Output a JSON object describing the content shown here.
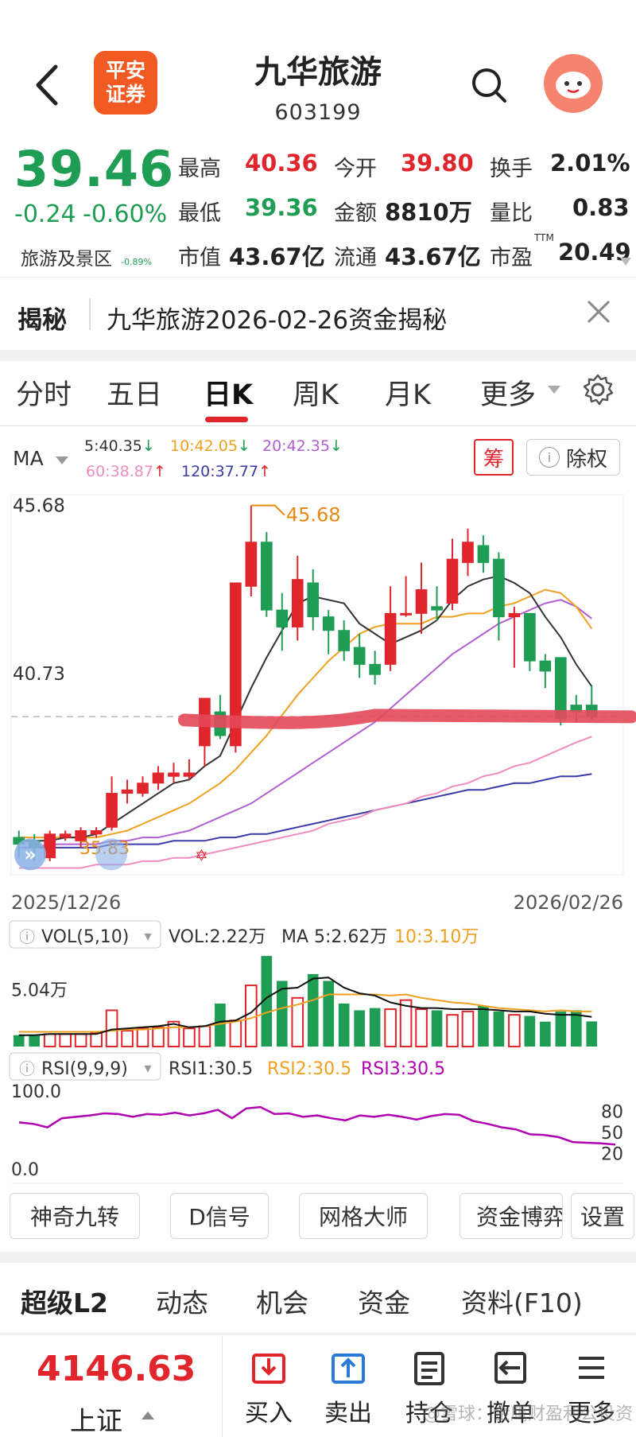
{
  "header": {
    "back_icon": "back-arrow-icon",
    "brand_logo": "平安证券",
    "stock_name": "九华旅游",
    "stock_code": "603199",
    "search_icon": "search-icon",
    "avatar_icon": "mascot-avatar-icon"
  },
  "quote": {
    "price": "39.46",
    "change": "-0.24",
    "change_pct": "-0.60%",
    "sector": "旅游及景区",
    "sector_pct": "-0.89%",
    "high_label": "最高",
    "high": "40.36",
    "low_label": "最低",
    "low": "39.36",
    "open_label": "今开",
    "open": "39.80",
    "amount_label": "金额",
    "amount": "8810万",
    "turnover_label": "换手",
    "turnover": "2.01%",
    "vol_ratio_label": "量比",
    "vol_ratio": "0.83",
    "mktcap_label": "市值",
    "mktcap": "43.67亿",
    "float_label": "流通",
    "float": "43.67亿",
    "pe_label": "市盈",
    "pe_sup": "TTM",
    "pe": "20.49"
  },
  "news": {
    "tag": "揭秘",
    "text": "九华旅游2026-02-26资金揭秘",
    "close_icon": "close-icon"
  },
  "tabs": {
    "items": [
      "分时",
      "五日",
      "日K",
      "周K",
      "月K",
      "更多"
    ],
    "active": "日K",
    "settings_icon": "gear-icon"
  },
  "chart_legend": {
    "ma_label": "MA",
    "ma5": "5:40.35",
    "ma10": "10:42.05",
    "ma20": "20:42.35",
    "ma60": "60:38.87",
    "ma120": "120:37.77",
    "chip_btn": "筹",
    "exright_btn": "除权"
  },
  "colors": {
    "up": "#e0252c",
    "down": "#1f9d55",
    "ma5": "#333333",
    "ma10": "#f0a020",
    "ma20": "#b05fd0",
    "ma60": "#f08cc0",
    "ma120": "#3a3aa8",
    "rsi": "#b000b0"
  },
  "chart_data": [
    {
      "type": "candlestick",
      "y_tick_labels": [
        "45.68",
        "40.73"
      ],
      "annotations": [
        "45.68",
        "35.83"
      ],
      "x_labels": [
        "2025/12/26",
        "2026/02/26"
      ],
      "ylim": [
        34.8,
        46.0
      ],
      "candles": [
        {
          "o": 35.9,
          "c": 35.7,
          "h": 36.1,
          "l": 35.3
        },
        {
          "o": 35.8,
          "c": 35.6,
          "h": 36.0,
          "l": 35.2
        },
        {
          "o": 35.3,
          "c": 36.0,
          "h": 36.1,
          "l": 35.2
        },
        {
          "o": 35.9,
          "c": 36.0,
          "h": 36.1,
          "l": 35.8
        },
        {
          "o": 35.8,
          "c": 36.1,
          "h": 36.2,
          "l": 35.6
        },
        {
          "o": 36.0,
          "c": 36.1,
          "h": 36.2,
          "l": 35.9
        },
        {
          "o": 36.2,
          "c": 37.2,
          "h": 37.7,
          "l": 36.1
        },
        {
          "o": 37.2,
          "c": 37.3,
          "h": 37.6,
          "l": 36.9
        },
        {
          "o": 37.2,
          "c": 37.5,
          "h": 37.7,
          "l": 37.1
        },
        {
          "o": 37.5,
          "c": 37.8,
          "h": 38.0,
          "l": 37.3
        },
        {
          "o": 37.7,
          "c": 37.8,
          "h": 38.1,
          "l": 37.5
        },
        {
          "o": 37.7,
          "c": 37.8,
          "h": 38.2,
          "l": 37.6
        },
        {
          "o": 38.6,
          "c": 40.0,
          "h": 40.0,
          "l": 38.0
        },
        {
          "o": 39.6,
          "c": 38.9,
          "h": 40.1,
          "l": 38.8
        },
        {
          "o": 38.6,
          "c": 43.4,
          "h": 43.4,
          "l": 38.4
        },
        {
          "o": 43.3,
          "c": 44.6,
          "h": 45.68,
          "l": 43.0
        },
        {
          "o": 44.6,
          "c": 42.6,
          "h": 44.9,
          "l": 42.4
        },
        {
          "o": 42.6,
          "c": 42.1,
          "h": 43.1,
          "l": 41.4
        },
        {
          "o": 42.1,
          "c": 43.5,
          "h": 44.2,
          "l": 41.7
        },
        {
          "o": 43.4,
          "c": 42.4,
          "h": 43.8,
          "l": 42.0
        },
        {
          "o": 42.4,
          "c": 42.0,
          "h": 42.6,
          "l": 41.3
        },
        {
          "o": 42.0,
          "c": 41.4,
          "h": 42.3,
          "l": 41.1
        },
        {
          "o": 41.5,
          "c": 41.0,
          "h": 41.9,
          "l": 40.6
        },
        {
          "o": 41.0,
          "c": 40.7,
          "h": 41.4,
          "l": 40.4
        },
        {
          "o": 41.0,
          "c": 42.5,
          "h": 43.3,
          "l": 40.8
        },
        {
          "o": 42.5,
          "c": 42.5,
          "h": 43.6,
          "l": 42.4
        },
        {
          "o": 42.5,
          "c": 43.2,
          "h": 44.0,
          "l": 41.9
        },
        {
          "o": 42.7,
          "c": 42.6,
          "h": 43.3,
          "l": 42.3
        },
        {
          "o": 42.8,
          "c": 44.1,
          "h": 44.7,
          "l": 42.6
        },
        {
          "o": 44.0,
          "c": 44.6,
          "h": 45.0,
          "l": 43.6
        },
        {
          "o": 44.5,
          "c": 44.0,
          "h": 44.8,
          "l": 43.7
        },
        {
          "o": 44.1,
          "c": 42.4,
          "h": 44.3,
          "l": 41.7
        },
        {
          "o": 42.4,
          "c": 42.5,
          "h": 42.7,
          "l": 40.9
        },
        {
          "o": 42.5,
          "c": 41.1,
          "h": 42.5,
          "l": 40.8
        },
        {
          "o": 41.1,
          "c": 40.8,
          "h": 41.3,
          "l": 40.3
        },
        {
          "o": 41.2,
          "c": 39.4,
          "h": 41.2,
          "l": 39.2
        },
        {
          "o": 39.8,
          "c": 39.6,
          "h": 40.1,
          "l": 39.3
        },
        {
          "o": 39.8,
          "c": 39.46,
          "h": 40.36,
          "l": 39.36
        }
      ],
      "ma5": [
        35.8,
        35.8,
        35.8,
        35.9,
        35.9,
        36.0,
        36.3,
        36.6,
        36.9,
        37.2,
        37.5,
        37.6,
        38.0,
        38.3,
        39.3,
        40.3,
        41.2,
        42.0,
        42.8,
        43.0,
        42.9,
        42.8,
        42.2,
        41.9,
        41.6,
        41.8,
        42.0,
        42.3,
        42.9,
        43.3,
        43.5,
        43.6,
        43.4,
        43.1,
        42.4,
        41.8,
        41.0,
        40.35
      ],
      "ma10": [
        35.9,
        35.9,
        35.9,
        35.9,
        35.9,
        35.9,
        36.0,
        36.1,
        36.3,
        36.5,
        36.7,
        36.9,
        37.2,
        37.5,
        37.9,
        38.4,
        38.9,
        39.5,
        40.1,
        40.6,
        41.1,
        41.5,
        41.9,
        42.1,
        42.2,
        42.2,
        42.2,
        42.4,
        42.4,
        42.5,
        42.5,
        42.7,
        42.8,
        43.0,
        43.2,
        43.1,
        42.7,
        42.05
      ],
      "ma20": [
        35.6,
        35.6,
        35.7,
        35.7,
        35.7,
        35.7,
        35.8,
        35.8,
        35.9,
        35.9,
        36.0,
        36.1,
        36.3,
        36.5,
        36.7,
        36.9,
        37.2,
        37.5,
        37.8,
        38.1,
        38.4,
        38.7,
        39.0,
        39.3,
        39.7,
        40.1,
        40.5,
        40.9,
        41.3,
        41.6,
        41.9,
        42.2,
        42.4,
        42.6,
        42.8,
        42.9,
        42.7,
        42.35
      ],
      "ma60": [
        35.0,
        35.0,
        35.0,
        35.0,
        35.0,
        35.1,
        35.1,
        35.1,
        35.2,
        35.2,
        35.3,
        35.3,
        35.4,
        35.5,
        35.6,
        35.7,
        35.8,
        35.9,
        36.0,
        36.1,
        36.3,
        36.4,
        36.5,
        36.7,
        36.8,
        36.9,
        37.1,
        37.2,
        37.4,
        37.5,
        37.7,
        37.8,
        38.0,
        38.1,
        38.3,
        38.5,
        38.7,
        38.87
      ],
      "ma120": [
        35.6,
        35.6,
        35.6,
        35.6,
        35.6,
        35.6,
        35.7,
        35.7,
        35.7,
        35.7,
        35.8,
        35.8,
        35.8,
        35.9,
        35.9,
        36.0,
        36.0,
        36.1,
        36.2,
        36.3,
        36.4,
        36.5,
        36.6,
        36.7,
        36.8,
        36.9,
        37.0,
        37.1,
        37.2,
        37.3,
        37.3,
        37.4,
        37.5,
        37.5,
        37.6,
        37.7,
        37.7,
        37.77
      ],
      "support_line": 39.5
    },
    {
      "type": "bar",
      "title": "VOL(5,10)",
      "readout": "VOL:2.22万",
      "ma5_readout": "MA 5:2.62万",
      "ma10_readout": "10:3.10万",
      "y_tick_label": "5.04万",
      "ylim": [
        0,
        8.5
      ],
      "values": [
        1.0,
        1.0,
        1.1,
        1.1,
        1.1,
        1.2,
        3.2,
        1.4,
        1.6,
        1.7,
        2.2,
        1.6,
        1.8,
        3.8,
        2.3,
        5.4,
        8.0,
        5.8,
        4.3,
        6.4,
        5.8,
        3.8,
        3.2,
        3.4,
        3.3,
        4.1,
        3.3,
        3.2,
        2.8,
        3.1,
        3.6,
        3.1,
        2.8,
        2.7,
        2.2,
        3.1,
        3.2,
        2.22
      ],
      "ma5_line": [
        1.0,
        1.0,
        1.1,
        1.1,
        1.1,
        1.1,
        1.5,
        1.6,
        1.7,
        1.8,
        2.0,
        1.7,
        1.8,
        2.2,
        2.3,
        3.0,
        4.3,
        5.1,
        5.2,
        6.0,
        6.1,
        5.2,
        4.7,
        4.5,
        3.9,
        3.6,
        3.4,
        3.4,
        3.3,
        3.3,
        3.3,
        3.2,
        3.1,
        3.1,
        2.9,
        2.8,
        2.8,
        2.62
      ],
      "ma10_line": [
        1.3,
        1.3,
        1.3,
        1.3,
        1.3,
        1.3,
        1.4,
        1.5,
        1.5,
        1.6,
        1.7,
        1.7,
        1.8,
        2.0,
        2.2,
        2.5,
        3.0,
        3.4,
        3.7,
        4.1,
        4.6,
        4.6,
        4.6,
        4.6,
        4.5,
        4.6,
        4.3,
        4.1,
        3.9,
        3.8,
        3.6,
        3.4,
        3.3,
        3.2,
        3.1,
        3.2,
        3.1,
        3.1
      ]
    },
    {
      "type": "line",
      "title": "RSI(9,9,9)",
      "rsi1_readout": "RSI1:30.5",
      "rsi2_readout": "RSI2:30.5",
      "rsi3_readout": "RSI3:30.5",
      "y_left_ticks": [
        "100.0",
        "0.0"
      ],
      "y_right_ticks": [
        "80",
        "50",
        "20"
      ],
      "ylim": [
        0,
        100
      ],
      "values": [
        62,
        60,
        55,
        68,
        70,
        72,
        75,
        74,
        70,
        74,
        73,
        76,
        72,
        75,
        80,
        68,
        82,
        84,
        74,
        75,
        70,
        72,
        68,
        65,
        72,
        70,
        73,
        70,
        66,
        71,
        74,
        73,
        64,
        60,
        55,
        52,
        45,
        44,
        41,
        34,
        33,
        32,
        30.5
      ]
    }
  ],
  "toolbar_buttons": [
    "神奇九转",
    "D信号",
    "网格大师",
    "资金博弈",
    "设置"
  ],
  "bottom_tabs": [
    "超级L2",
    "动态",
    "机会",
    "资金",
    "资料(F10)"
  ],
  "footer": {
    "index_value": "4146.63",
    "index_name": "上证",
    "actions": [
      {
        "label": "买入",
        "icon": "buy-icon"
      },
      {
        "label": "卖出",
        "icon": "sell-icon"
      },
      {
        "label": "持仓",
        "icon": "position-icon"
      },
      {
        "label": "撤单",
        "icon": "cancel-order-icon"
      },
      {
        "label": "更多",
        "icon": "more-menu-icon"
      }
    ],
    "watermark": "@雪球：金鹰财盈利公投资"
  }
}
